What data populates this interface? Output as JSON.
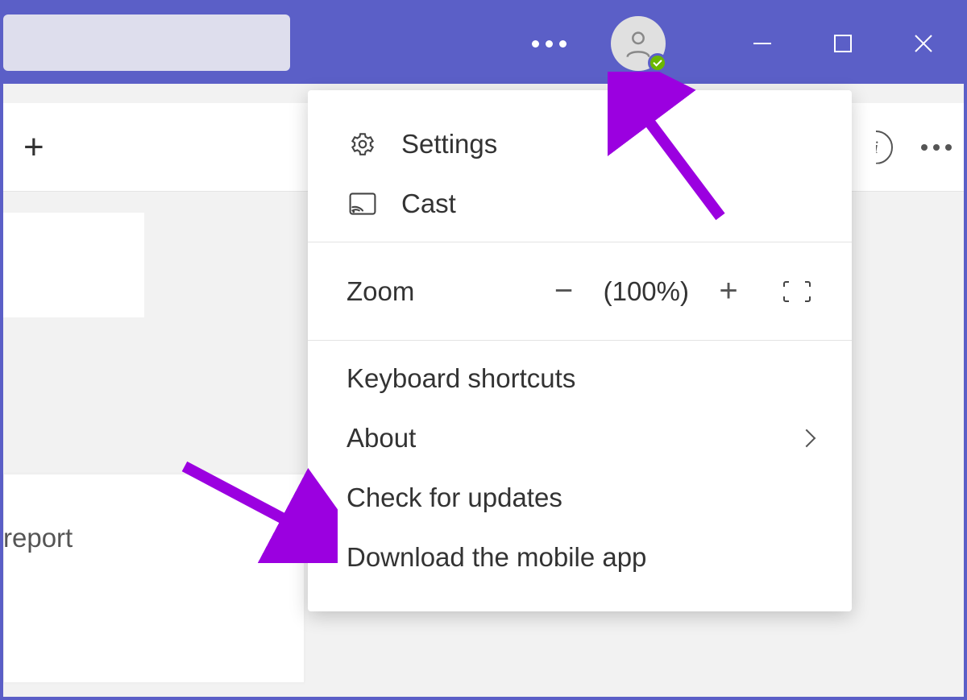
{
  "titlebar": {
    "more_label": "More",
    "avatar_label": "Profile",
    "presence": "available"
  },
  "background": {
    "partial_text": "report"
  },
  "menu": {
    "settings": "Settings",
    "cast": "Cast",
    "zoom": {
      "label": "Zoom",
      "value": "(100%)"
    },
    "keyboard_shortcuts": "Keyboard shortcuts",
    "about": "About",
    "check_updates": "Check for updates",
    "download_mobile": "Download the mobile app"
  }
}
